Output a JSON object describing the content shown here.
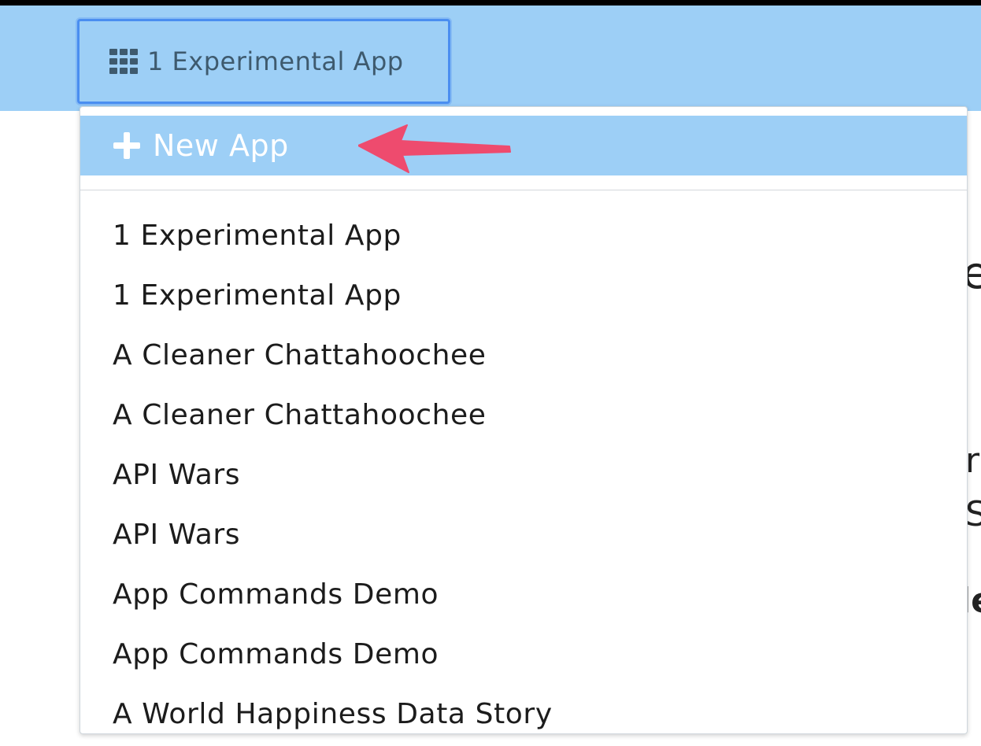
{
  "header": {
    "app_switcher_label": "1 Experimental App"
  },
  "dropdown": {
    "new_app_label": "New App",
    "apps": [
      "1 Experimental App",
      "1 Experimental App",
      "A Cleaner Chattahoochee",
      "A Cleaner Chattahoochee",
      "API Wars",
      "API Wars",
      "App Commands Demo",
      "App Commands Demo",
      "A World Happiness Data Story"
    ]
  },
  "background_fragments": [
    "e",
    "r",
    "S",
    "le"
  ],
  "colors": {
    "header_bg": "#9dcff6",
    "highlight": "#9dcff6",
    "focus_border": "#4a8ef0",
    "annotation_arrow": "#ee4b6e"
  },
  "icons": {
    "app_switcher": "grid-icon",
    "new_app": "plus-icon",
    "annotation": "arrow-icon"
  }
}
